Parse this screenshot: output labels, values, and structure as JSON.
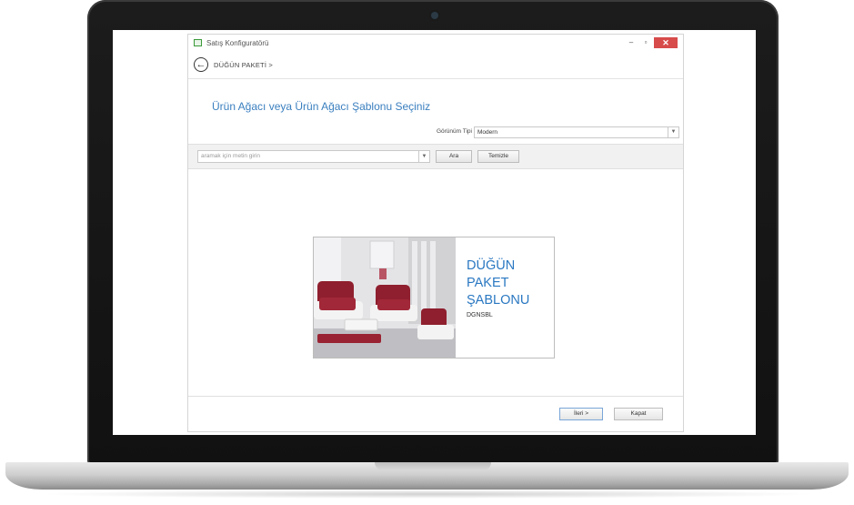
{
  "window": {
    "title": "Satış Konfiguratörü",
    "minimize": "–",
    "maximize": "▫",
    "close": "✕"
  },
  "nav": {
    "back": "←",
    "breadcrumb": "DÜĞÜN PAKETİ >"
  },
  "page": {
    "heading": "Ürün Ağacı veya Ürün Ağacı Şablonu Seçiniz"
  },
  "view_type": {
    "label": "Görünüm Tipi",
    "value": "Modern"
  },
  "search": {
    "placeholder": "aramak için metin girin",
    "search_button": "Ara",
    "clear_button": "Temizle"
  },
  "template": {
    "title": "DÜĞÜN\nPAKET\nŞABLONU",
    "code": "DGNSBL"
  },
  "footer": {
    "next_button": "İleri >",
    "close_button": "Kapat"
  },
  "colors": {
    "accent": "#3a7fbf",
    "card_title": "#2a78c2",
    "close_button": "#d74b4b",
    "sofa": "#8f1f2e"
  }
}
